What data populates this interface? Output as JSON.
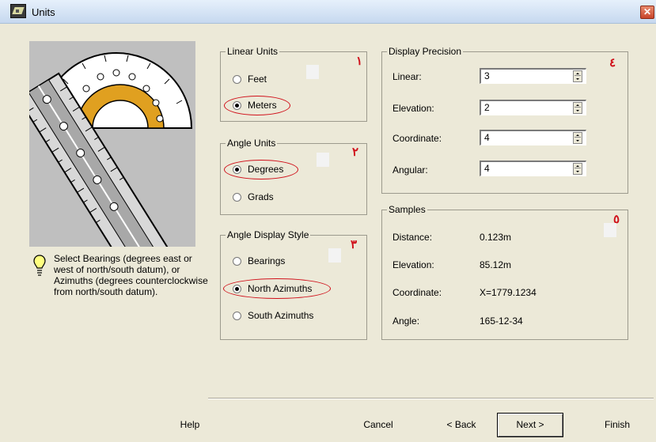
{
  "window": {
    "title": "Units",
    "close_glyph": "✕"
  },
  "hint": {
    "icon": "lightbulb-icon",
    "text": "Select Bearings (degrees east or west of north/south datum), or Azimuths (degrees counterclockwise from north/south datum)."
  },
  "linear_units": {
    "legend": "Linear Units",
    "mark": "١",
    "options": [
      {
        "label": "Feet",
        "selected": false
      },
      {
        "label": "Meters",
        "selected": true
      }
    ]
  },
  "angle_units": {
    "legend": "Angle Units",
    "mark": "٢",
    "options": [
      {
        "label": "Degrees",
        "selected": true
      },
      {
        "label": "Grads",
        "selected": false
      }
    ]
  },
  "angle_display_style": {
    "legend": "Angle Display Style",
    "mark": "٣",
    "options": [
      {
        "label": "Bearings",
        "selected": false
      },
      {
        "label": "North Azimuths",
        "selected": true
      },
      {
        "label": "South Azimuths",
        "selected": false
      }
    ]
  },
  "display_precision": {
    "legend": "Display Precision",
    "mark": "٤",
    "fields": [
      {
        "label": "Linear:",
        "value": "3"
      },
      {
        "label": "Elevation:",
        "value": "2"
      },
      {
        "label": "Coordinate:",
        "value": "4"
      },
      {
        "label": "Angular:",
        "value": "4"
      }
    ]
  },
  "samples": {
    "legend": "Samples",
    "mark": "٥",
    "rows": [
      {
        "label": "Distance:",
        "value": "0.123m"
      },
      {
        "label": "Elevation:",
        "value": "85.12m"
      },
      {
        "label": "Coordinate:",
        "value": "X=1779.1234"
      },
      {
        "label": "Angle:",
        "value": "165-12-34"
      }
    ]
  },
  "buttons": {
    "help": "Help",
    "cancel": "Cancel",
    "back": "< Back",
    "next": "Next >",
    "finish": "Finish"
  },
  "colors": {
    "annotation_red": "#d0101a",
    "dialog_bg": "#ece9d8"
  }
}
